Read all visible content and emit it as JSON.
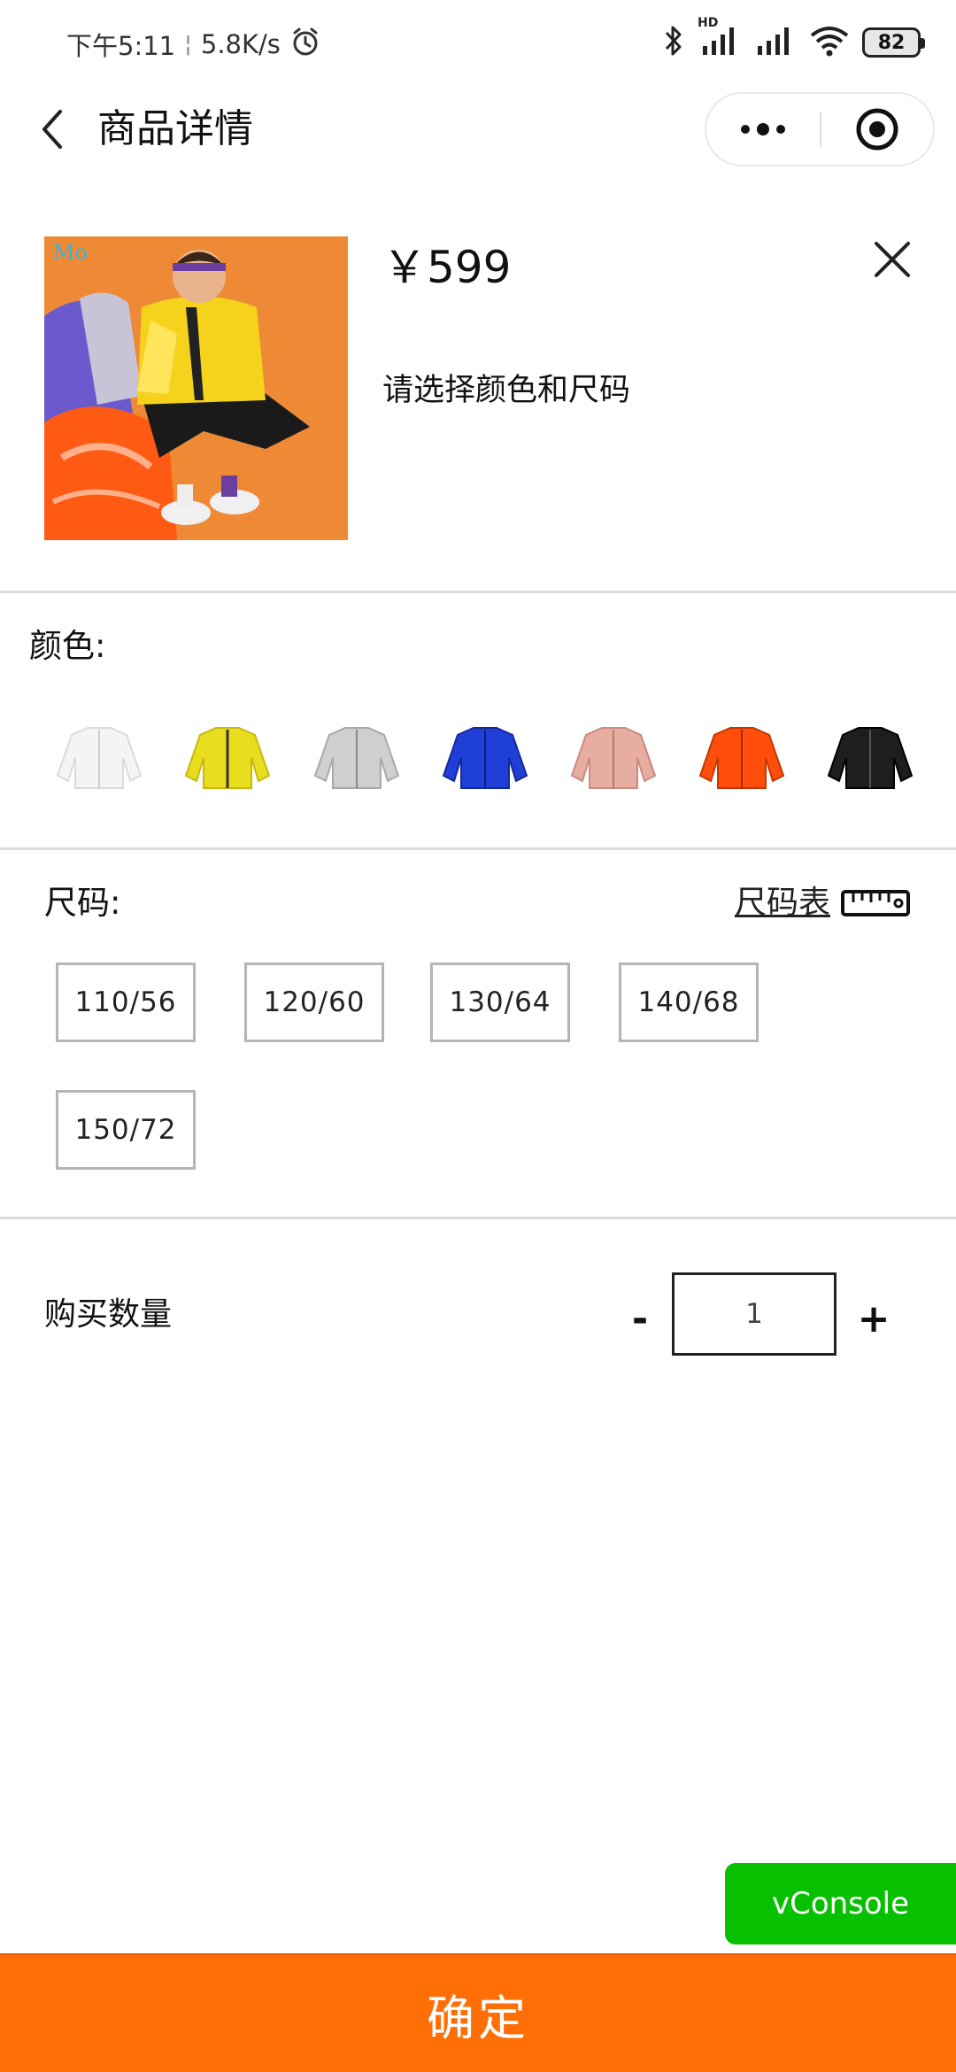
{
  "status_bar": {
    "time": "下午5:11",
    "net_speed": "5.8K/s",
    "battery": "82",
    "hd_label": "HD"
  },
  "nav": {
    "title": "商品详情"
  },
  "product": {
    "price": "￥599",
    "hint": "请选择颜色和尺码",
    "image_logo": "Mo"
  },
  "color_section": {
    "label": "颜色:",
    "swatches": [
      {
        "name": "white",
        "color": "#f4f4f4"
      },
      {
        "name": "yellow",
        "color": "#e8dd1e"
      },
      {
        "name": "silver",
        "color": "#cfcfcf"
      },
      {
        "name": "blue",
        "color": "#1f3fd6"
      },
      {
        "name": "pink",
        "color": "#e8ada1"
      },
      {
        "name": "orange",
        "color": "#ff4e0c"
      },
      {
        "name": "black",
        "color": "#1e1e1e"
      }
    ]
  },
  "size_section": {
    "label": "尺码:",
    "chart_link": "尺码表",
    "options": [
      "110/56",
      "120/60",
      "130/64",
      "140/68",
      "150/72"
    ]
  },
  "quantity": {
    "label": "购买数量",
    "minus": "-",
    "value": "1",
    "plus": "+"
  },
  "vconsole": {
    "label": "vConsole"
  },
  "confirm": {
    "label": "确定"
  },
  "colors": {
    "accent": "#ff6f05",
    "vconsole": "#07c000"
  }
}
